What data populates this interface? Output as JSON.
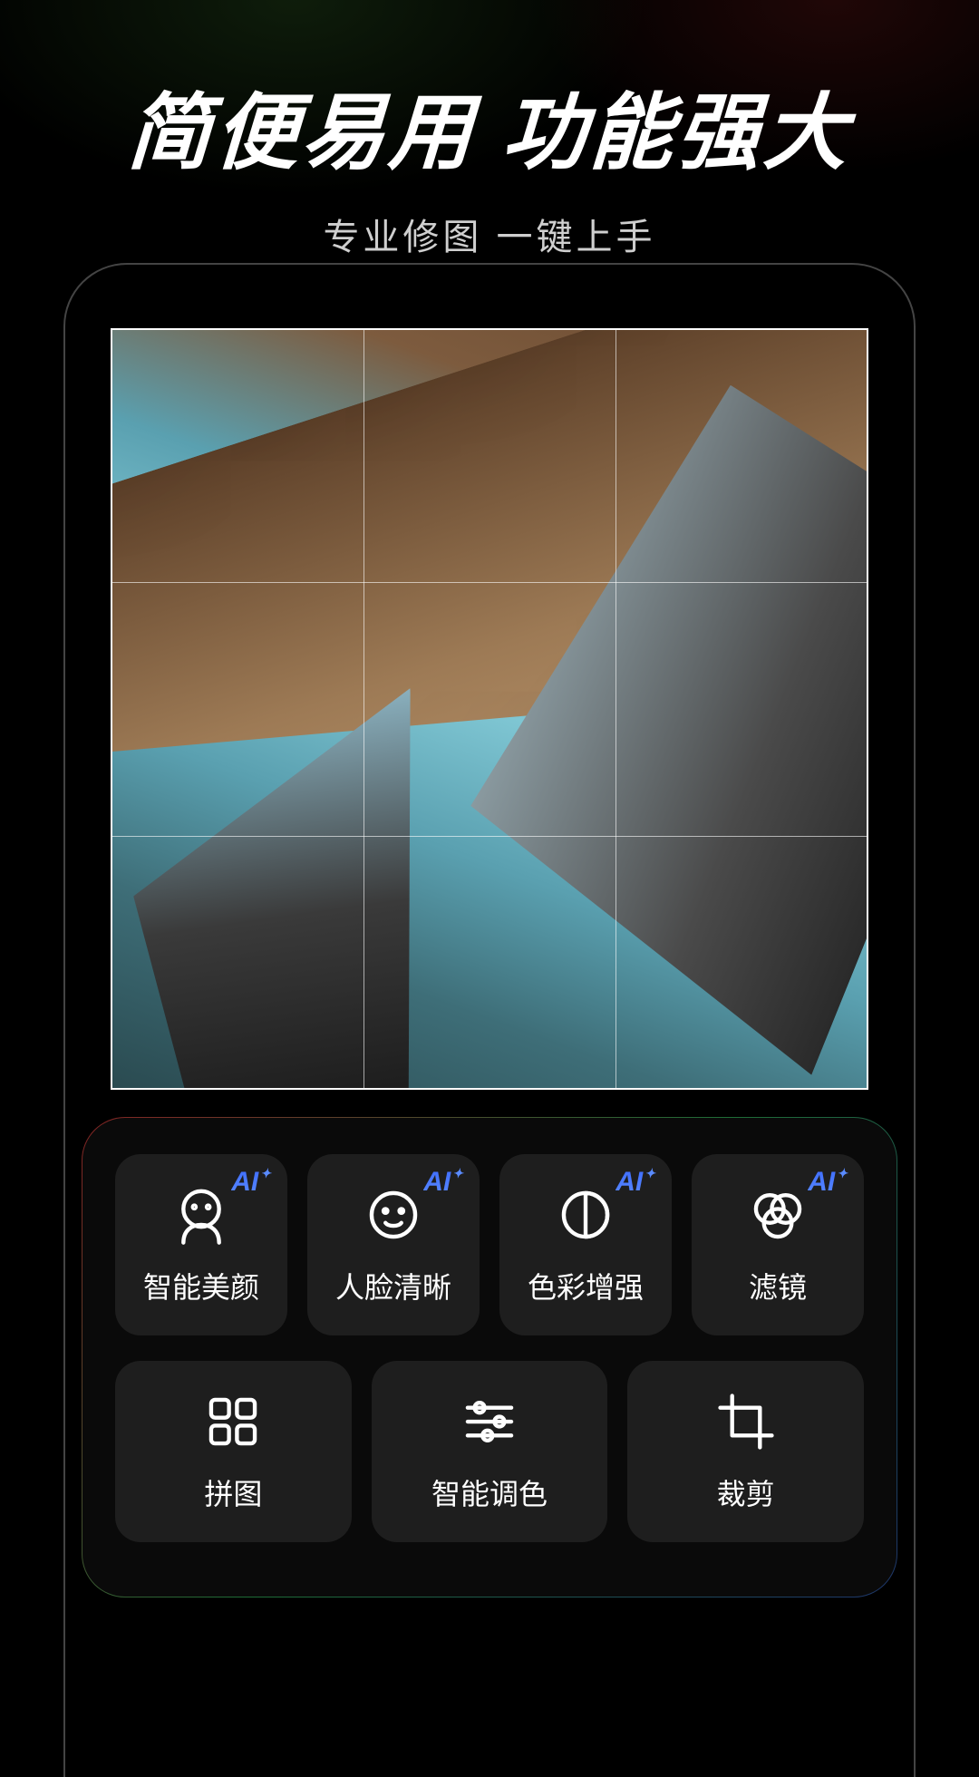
{
  "hero": {
    "title": "简便易用  功能强大",
    "subtitle": "专业修图   一键上手"
  },
  "ai_badge_label": "AI",
  "tools_row1": [
    {
      "label": "智能美颜",
      "icon": "face-beauty",
      "ai": true
    },
    {
      "label": "人脸清晰",
      "icon": "face-clear",
      "ai": true
    },
    {
      "label": "色彩增强",
      "icon": "contrast",
      "ai": true
    },
    {
      "label": "滤镜",
      "icon": "filter",
      "ai": true
    }
  ],
  "tools_row2": [
    {
      "label": "拼图",
      "icon": "grid"
    },
    {
      "label": "智能调色",
      "icon": "sliders"
    },
    {
      "label": "裁剪",
      "icon": "crop"
    }
  ]
}
